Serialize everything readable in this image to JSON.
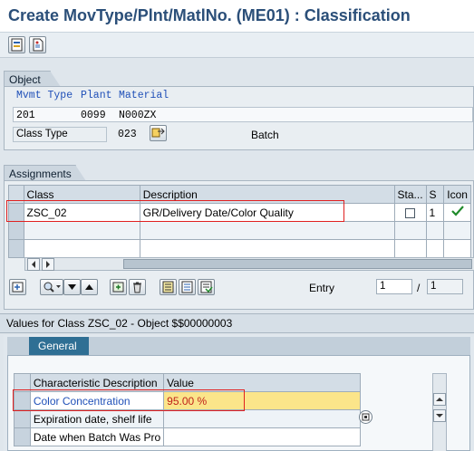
{
  "window": {
    "title": "Create MovType/Plnt/MatlNo. (ME01) : Classification"
  },
  "toolbar": {
    "buttons": [
      "overview-icon",
      "document-icon"
    ]
  },
  "object_section": {
    "title": "Object",
    "headers": {
      "mvmt_type": "Mvmt Type",
      "plant": "Plant",
      "material": "Material"
    },
    "values": {
      "mvmt_type": "201",
      "plant": "0099",
      "material": "N000ZX"
    },
    "class_type_label": "Class Type",
    "class_type_value": "023",
    "class_type_text": "Batch"
  },
  "assignments": {
    "title": "Assignments",
    "columns": {
      "class": "Class",
      "description": "Description",
      "status": "Sta...",
      "s": "S",
      "icon": "Icon"
    },
    "rows": [
      {
        "class": "ZSC_02",
        "description": "GR/Delivery Date/Color Quality",
        "s": "1"
      }
    ],
    "entry_label": "Entry",
    "entry_value": "1",
    "entry_separator": "/",
    "entry_total": "1"
  },
  "values_section": {
    "title": "Values for Class ZSC_02 - Object $$00000003",
    "tab_general": "General",
    "columns": {
      "char_desc": "Characteristic Description",
      "value": "Value"
    },
    "rows": [
      {
        "desc": "Color Concentration",
        "value": "95.00 %"
      },
      {
        "desc": "Expiration date, shelf life",
        "value": ""
      },
      {
        "desc": "Date when Batch Was Pro",
        "value": ""
      }
    ]
  },
  "colors": {
    "title_blue": "#2b4f79",
    "highlight_red": "#e02020",
    "value_yellow": "#fbe58a",
    "link_blue": "#2050b8"
  }
}
